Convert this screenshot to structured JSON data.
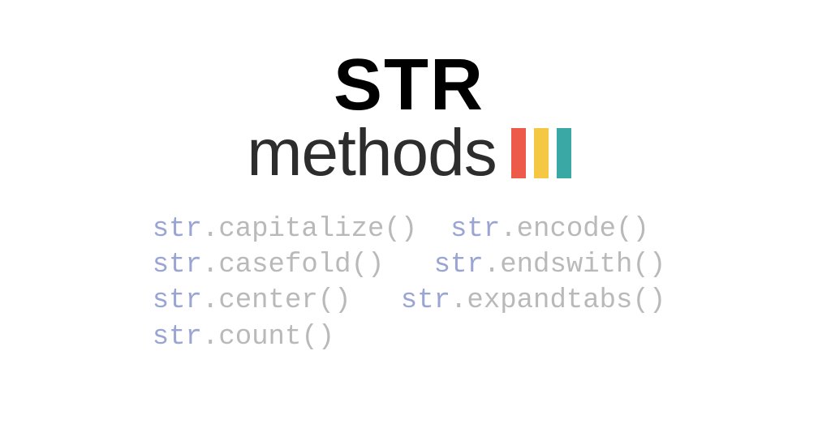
{
  "title": {
    "str": "STR",
    "methods": "methods"
  },
  "code": {
    "line1_col1_class": "str",
    "line1_col1_dot": ".",
    "line1_col1_method": "capitalize",
    "line1_col1_paren": "()",
    "line1_col2_class": "str",
    "line1_col2_dot": ".",
    "line1_col2_method": "encode",
    "line1_col2_paren": "()",
    "line2_col1_class": "str",
    "line2_col1_dot": ".",
    "line2_col1_method": "casefold",
    "line2_col1_paren": "()",
    "line2_col2_class": "str",
    "line2_col2_dot": ".",
    "line2_col2_method": "endswith",
    "line2_col2_paren": "()",
    "line3_col1_class": "str",
    "line3_col1_dot": ".",
    "line3_col1_method": "center",
    "line3_col1_paren": "()",
    "line3_col2_class": "str",
    "line3_col2_dot": ".",
    "line3_col2_method": "expandtabs",
    "line3_col2_paren": "()",
    "line4_col1_class": "str",
    "line4_col1_dot": ".",
    "line4_col1_method": "count",
    "line4_col1_paren": "()"
  }
}
